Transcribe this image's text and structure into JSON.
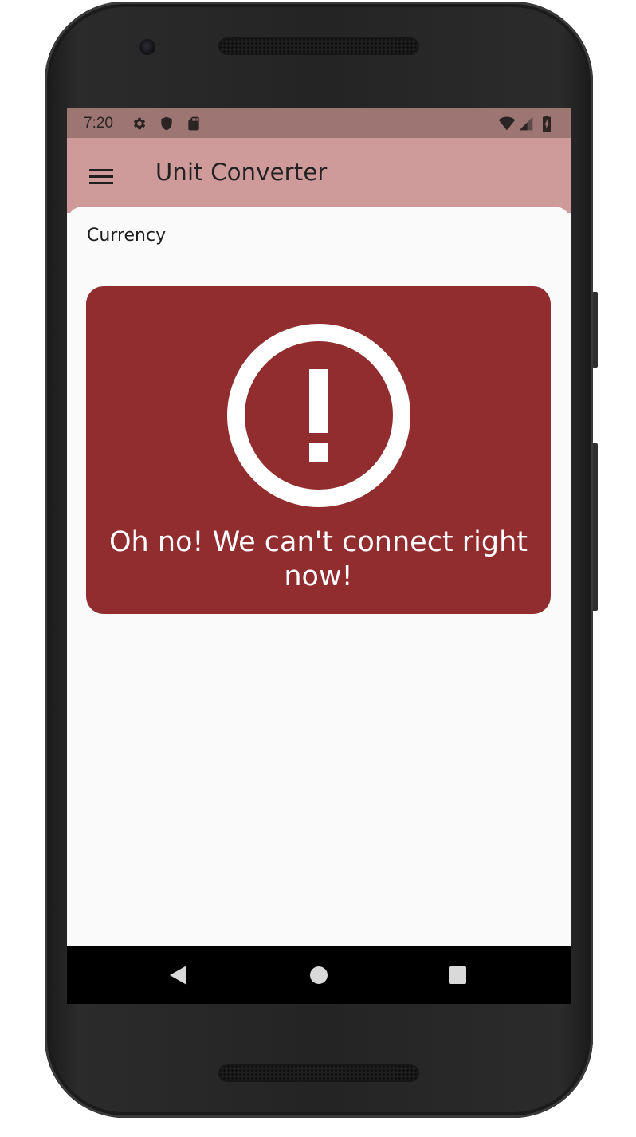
{
  "status_bar": {
    "time": "7:20",
    "left_icons": [
      "settings-icon",
      "shield-icon",
      "sd-card-icon"
    ],
    "right_icons": [
      "wifi-icon",
      "signal-icon",
      "battery-charging-icon"
    ],
    "color": "#9d7572"
  },
  "app_bar": {
    "title": "Unit Converter",
    "menu_icon": "hamburger-menu-icon",
    "color": "#cf9b9a"
  },
  "category": {
    "label": "Currency"
  },
  "error_card": {
    "icon": "error-circle-icon",
    "message": "Oh no! We can't connect right now!",
    "color": "#912d2f"
  },
  "nav_bar": {
    "buttons": [
      "back-icon",
      "home-icon",
      "recents-icon"
    ]
  }
}
